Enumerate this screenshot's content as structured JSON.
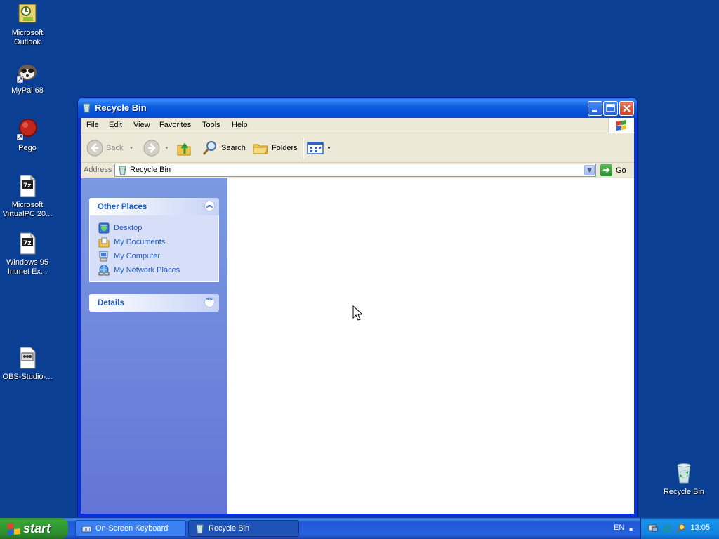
{
  "desktop": {
    "icons": [
      {
        "label": "Microsoft\nOutlook",
        "icon": "outlook-icon"
      },
      {
        "label": "MyPal 68",
        "icon": "mypal-icon"
      },
      {
        "label": "Pego",
        "icon": "pego-icon"
      },
      {
        "label": "Microsoft\nVirtualPC 20...",
        "icon": "7z-archive-icon"
      },
      {
        "label": "Windows 95\nIntrnet Ex...",
        "icon": "7z-archive-icon"
      },
      {
        "label": "OBS-Studio-...",
        "icon": "obs-installer-icon"
      },
      {
        "label": "Recycle Bin",
        "icon": "recycle-bin-icon"
      }
    ]
  },
  "window": {
    "title": "Recycle Bin",
    "menu": [
      "File",
      "Edit",
      "View",
      "Favorites",
      "Tools",
      "Help"
    ],
    "toolbar": {
      "back": "Back",
      "search": "Search",
      "folders": "Folders"
    },
    "address": {
      "label": "Address",
      "value": "Recycle Bin",
      "go": "Go"
    },
    "taskpane": {
      "other_places": {
        "title": "Other Places",
        "items": [
          "Desktop",
          "My Documents",
          "My Computer",
          "My Network Places"
        ]
      },
      "details": {
        "title": "Details"
      }
    }
  },
  "taskbar": {
    "start": "start",
    "tasks": [
      "On-Screen Keyboard",
      "Recycle Bin"
    ],
    "language": "EN",
    "clock": "13:05"
  },
  "colors": {
    "desktop": "#0a3f93",
    "title_bar": "#0b5ee0",
    "link": "#215dc6",
    "start_button": "#37a537"
  }
}
